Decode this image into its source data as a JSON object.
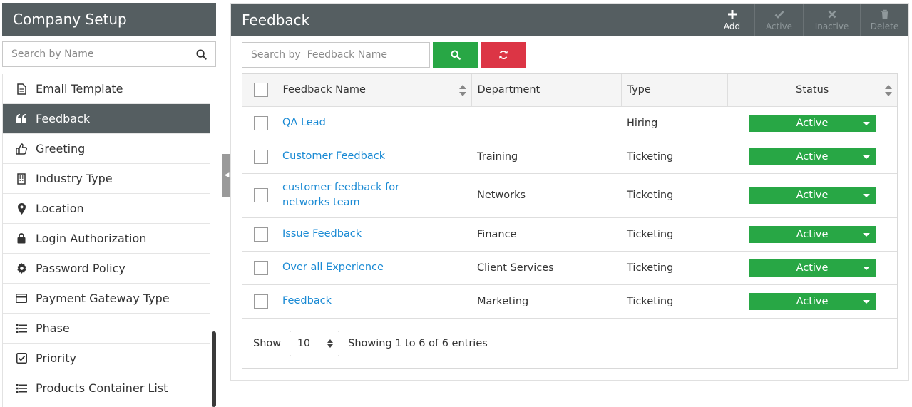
{
  "sidebar": {
    "title": "Company Setup",
    "search_placeholder": "Search by Name",
    "items": [
      {
        "label": "Email Template",
        "icon": "document-icon"
      },
      {
        "label": "Feedback",
        "icon": "quote-icon",
        "active": true
      },
      {
        "label": "Greeting",
        "icon": "thumbs-up-icon"
      },
      {
        "label": "Industry Type",
        "icon": "building-icon"
      },
      {
        "label": "Location",
        "icon": "map-pin-icon"
      },
      {
        "label": "Login Authorization",
        "icon": "lock-icon"
      },
      {
        "label": "Password Policy",
        "icon": "gear-icon"
      },
      {
        "label": "Payment Gateway Type",
        "icon": "credit-card-icon"
      },
      {
        "label": "Phase",
        "icon": "list-icon"
      },
      {
        "label": "Priority",
        "icon": "checkbox-icon"
      },
      {
        "label": "Products Container List",
        "icon": "list-icon"
      }
    ]
  },
  "main": {
    "title": "Feedback",
    "toolbar": {
      "add": "Add",
      "active": "Active",
      "inactive": "Inactive",
      "delete": "Delete"
    },
    "search_placeholder": "Search by  Feedback Name",
    "columns": {
      "name": "Feedback Name",
      "department": "Department",
      "type": "Type",
      "status": "Status"
    },
    "rows": [
      {
        "name": "QA Lead",
        "department": "",
        "type": "Hiring",
        "status": "Active"
      },
      {
        "name": "Customer Feedback",
        "department": "Training",
        "type": "Ticketing",
        "status": "Active"
      },
      {
        "name": "customer feedback for networks team",
        "department": "Networks",
        "type": "Ticketing",
        "status": "Active"
      },
      {
        "name": "Issue Feedback",
        "department": "Finance",
        "type": "Ticketing",
        "status": "Active"
      },
      {
        "name": "Over all Experience",
        "department": "Client Services",
        "type": "Ticketing",
        "status": "Active"
      },
      {
        "name": "Feedback",
        "department": "Marketing",
        "type": "Ticketing",
        "status": "Active"
      }
    ],
    "footer": {
      "show_label": "Show",
      "page_size": "10",
      "info": "Showing 1 to 6 of 6 entries"
    }
  },
  "colors": {
    "header": "#555e61",
    "success": "#28a745",
    "danger": "#dc3545",
    "link": "#1a8ad4"
  }
}
